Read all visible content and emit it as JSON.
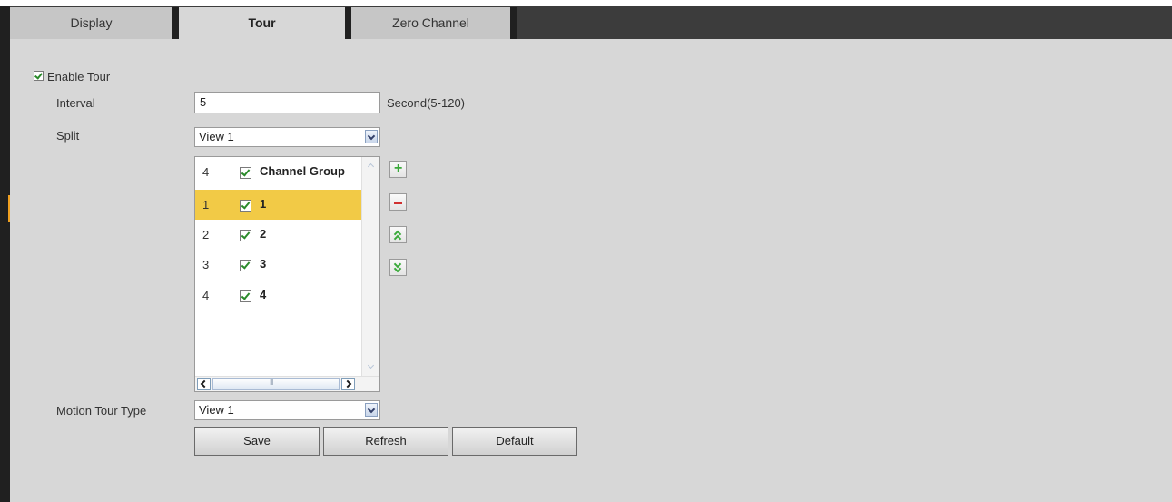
{
  "tabs": [
    {
      "label": "Display",
      "active": false
    },
    {
      "label": "Tour",
      "active": true
    },
    {
      "label": "Zero Channel",
      "active": false
    }
  ],
  "enable_tour": {
    "label": "Enable Tour",
    "checked": true
  },
  "interval": {
    "label": "Interval",
    "value": "5",
    "hint": "Second(5-120)"
  },
  "split": {
    "label": "Split",
    "value": "View 1"
  },
  "channel_list": {
    "header": {
      "index": "4",
      "label": "Channel Group",
      "checked": true
    },
    "rows": [
      {
        "index": "1",
        "label": "1",
        "checked": true,
        "selected": true
      },
      {
        "index": "2",
        "label": "2",
        "checked": true,
        "selected": false
      },
      {
        "index": "3",
        "label": "3",
        "checked": true,
        "selected": false
      },
      {
        "index": "4",
        "label": "4",
        "checked": true,
        "selected": false
      }
    ]
  },
  "side_buttons": {
    "add": "+",
    "remove": "minus-icon",
    "move_up": "double-chevron-up-icon",
    "move_down": "double-chevron-down-icon"
  },
  "motion_tour_type": {
    "label": "Motion Tour Type",
    "value": "View 1"
  },
  "buttons": {
    "save": "Save",
    "refresh": "Refresh",
    "default": "Default"
  },
  "colors": {
    "selected_row": "#f2ca46",
    "panel": "#d7d7d7",
    "tabbar": "#3c3c3c"
  }
}
